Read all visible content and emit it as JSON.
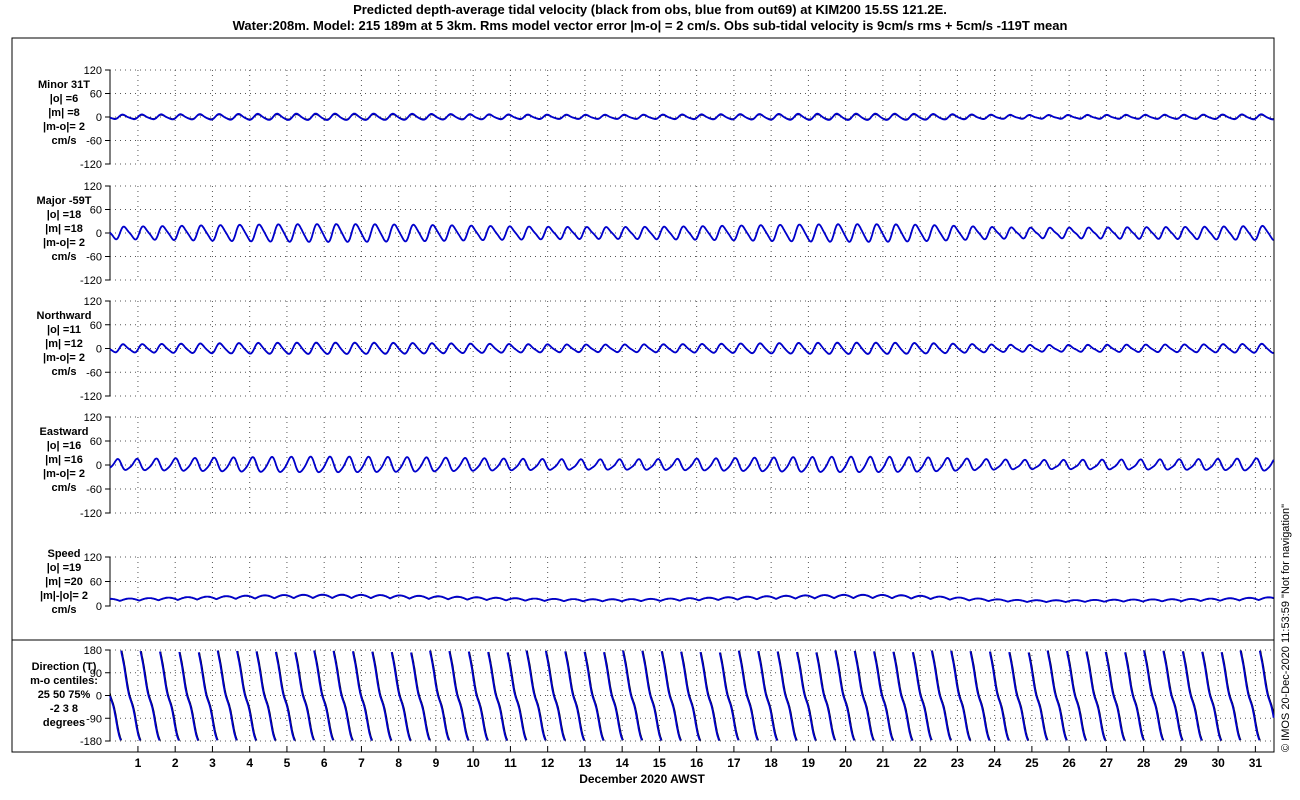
{
  "title": {
    "line1": "Predicted depth-average tidal velocity (black from obs, blue from out69) at KIM200 15.5S 121.2E.",
    "line2": "Water:208m. Model: 215 189m at 5 3km. Rms model vector error |m-o| = 2 cm/s. Obs sub-tidal velocity is 9cm/s rms + 5cm/s -119T mean"
  },
  "side_note": "© IMOS 20-Dec-2020 11:53:59 \"Not for navigation\"",
  "xaxis": {
    "label": "December 2020 AWST",
    "ticks": [
      "1",
      "2",
      "3",
      "4",
      "5",
      "6",
      "7",
      "8",
      "9",
      "10",
      "11",
      "12",
      "13",
      "14",
      "15",
      "16",
      "17",
      "18",
      "19",
      "20",
      "21",
      "22",
      "23",
      "24",
      "25",
      "26",
      "27",
      "28",
      "29",
      "30",
      "31"
    ]
  },
  "colors": {
    "obs": "#000000",
    "model": "#0000cc",
    "grid": "#555555"
  },
  "chart_data": [
    {
      "type": "line",
      "panel": "minor",
      "labels": [
        "Minor 31T",
        "|o| =6",
        "|m| =8",
        "|m-o|= 2",
        "cm/s"
      ],
      "yticks": [
        "120",
        "60",
        "0",
        "-60",
        "-120"
      ],
      "ylim": [
        -120,
        120
      ],
      "series": [
        {
          "name": "black from obs",
          "amplitude": 6,
          "phase": 0.5,
          "offset": 0
        },
        {
          "name": "blue from out69",
          "amplitude": 8,
          "phase": 0.5,
          "offset": 0
        }
      ]
    },
    {
      "type": "line",
      "panel": "major",
      "labels": [
        "Major -59T",
        "|o| =18",
        "|m| =18",
        "|m-o|= 2",
        "cm/s"
      ],
      "yticks": [
        "120",
        "60",
        "0",
        "-60",
        "-120"
      ],
      "ylim": [
        -120,
        120
      ],
      "series": [
        {
          "name": "black from obs",
          "amplitude": 22,
          "phase": 0,
          "offset": 0
        },
        {
          "name": "blue from out69",
          "amplitude": 22,
          "phase": 0,
          "offset": 0
        }
      ]
    },
    {
      "type": "line",
      "panel": "northward",
      "labels": [
        "Northward",
        "|o| =11",
        "|m| =12",
        "|m-o|= 2",
        "cm/s"
      ],
      "yticks": [
        "120",
        "60",
        "0",
        "-60",
        "-120"
      ],
      "ylim": [
        -120,
        120
      ],
      "series": [
        {
          "name": "black from obs",
          "amplitude": 13,
          "phase": 0.3,
          "offset": 0
        },
        {
          "name": "blue from out69",
          "amplitude": 14,
          "phase": 0.3,
          "offset": 0
        }
      ]
    },
    {
      "type": "line",
      "panel": "eastward",
      "labels": [
        "Eastward",
        "|o| =16",
        "|m| =16",
        "|m-o|= 2",
        "cm/s"
      ],
      "yticks": [
        "120",
        "60",
        "0",
        "-60",
        "-120"
      ],
      "ylim": [
        -120,
        120
      ],
      "series": [
        {
          "name": "black from obs",
          "amplitude": 19,
          "phase": 2.5,
          "offset": 0
        },
        {
          "name": "blue from out69",
          "amplitude": 19,
          "phase": 2.5,
          "offset": 0
        }
      ]
    },
    {
      "type": "line",
      "panel": "speed",
      "labels": [
        "Speed",
        "|o| =19",
        "|m| =20",
        "|m|-|o|= 2",
        "cm/s"
      ],
      "yticks": [
        "120",
        "60",
        "0"
      ],
      "ylim": [
        0,
        120
      ],
      "series": [
        {
          "name": "black from obs",
          "amplitude": 8,
          "phase": 0,
          "offset": 22
        },
        {
          "name": "blue from out69",
          "amplitude": 8,
          "phase": 0,
          "offset": 23
        }
      ]
    },
    {
      "type": "line",
      "panel": "direction",
      "labels": [
        "Direction (T)",
        "m-o centiles:",
        "25  50  75%",
        "-2  3  8",
        "degrees"
      ],
      "yticks": [
        "180",
        "90",
        "0",
        "-90",
        "-180"
      ],
      "ylim": [
        -180,
        180
      ],
      "series": [
        {
          "name": "black from obs",
          "cycles_per_day": 1.93
        },
        {
          "name": "blue from out69",
          "cycles_per_day": 1.93
        }
      ]
    }
  ]
}
